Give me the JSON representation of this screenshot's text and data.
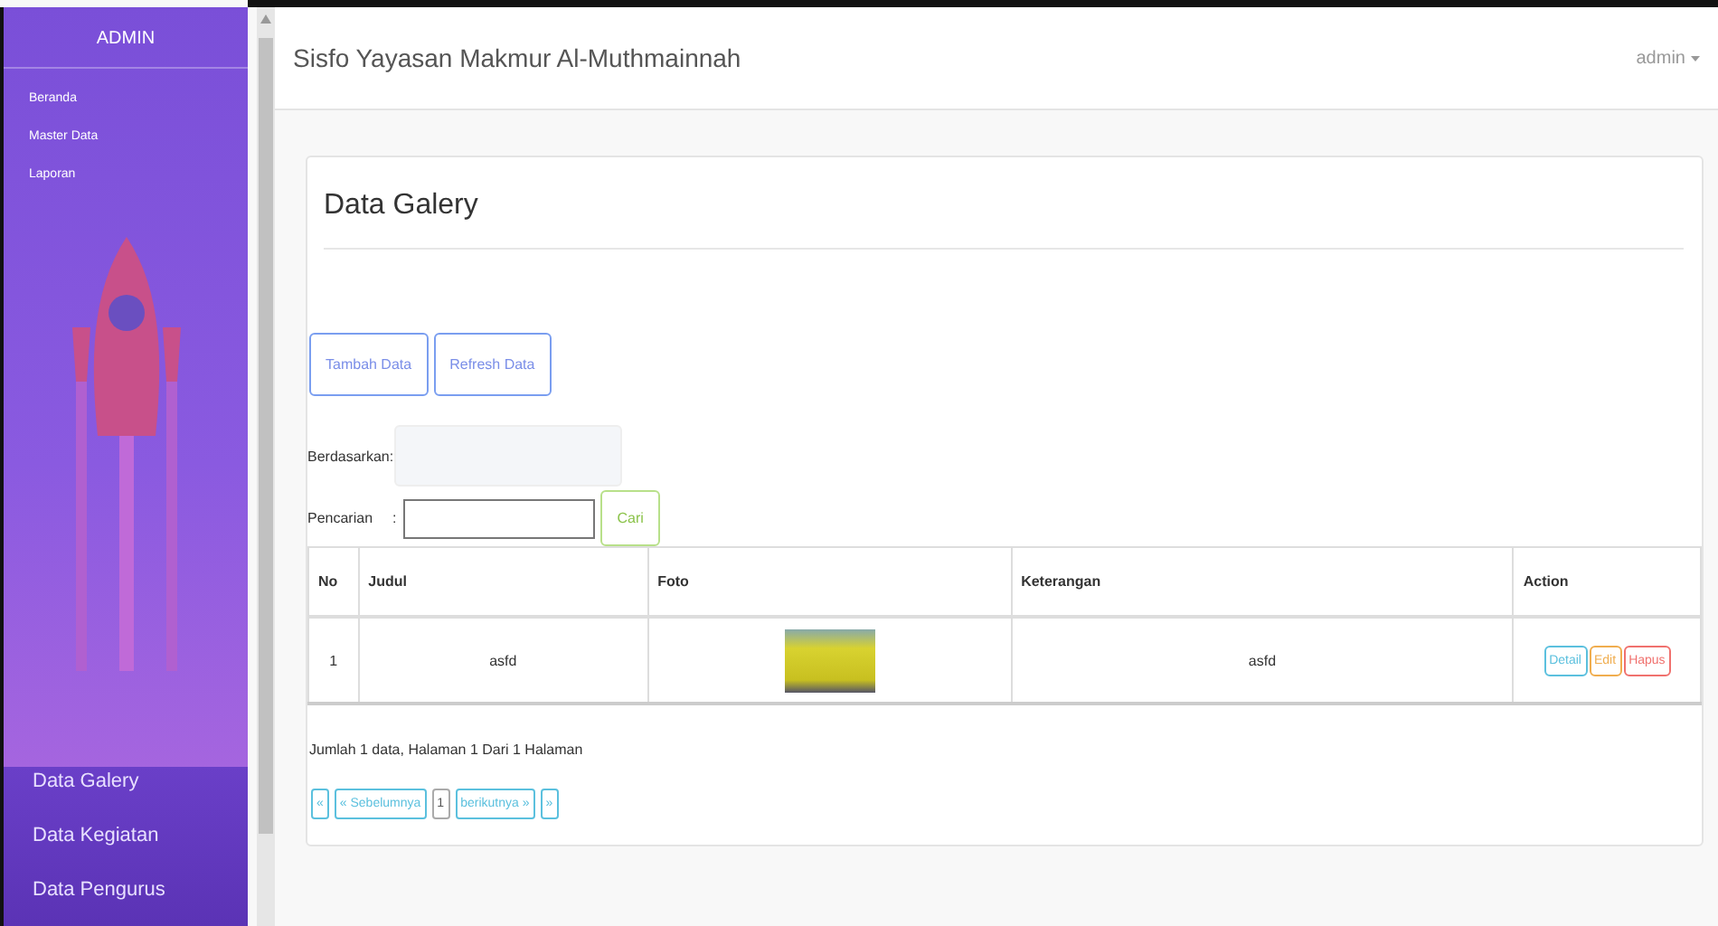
{
  "sidebar": {
    "title": "ADMIN",
    "menu": [
      "Beranda",
      "Master Data",
      "Laporan"
    ],
    "submenu": [
      "Data Galery",
      "Data Kegiatan",
      "Data Pengurus"
    ]
  },
  "navbar": {
    "brand": "Sisfo Yayasan Makmur Al-Muthmainnah",
    "user": "admin"
  },
  "panel": {
    "title": "Data Galery",
    "buttons": [
      "Tambah Data",
      "Refresh Data"
    ],
    "filter": {
      "label": "Berdasarkan:"
    },
    "search": {
      "label": "Pencarian",
      "separator": ":",
      "button": "Cari"
    },
    "table": {
      "columns": [
        "No",
        "Judul",
        "Foto",
        "Keterangan",
        "Action"
      ],
      "rows": [
        {
          "no": "1",
          "judul": "asfd",
          "keterangan": "asfd",
          "actions": [
            {
              "label": "Detail",
              "kind": "detail"
            },
            {
              "label": "Edit",
              "kind": "edit"
            },
            {
              "label": "Hapus",
              "kind": "delete"
            }
          ]
        }
      ]
    },
    "summary": "Jumlah 1 data, Halaman 1 Dari 1 Halaman",
    "pagination": [
      {
        "label": "«",
        "selected": false
      },
      {
        "label": "« Sebelumnya",
        "selected": false
      },
      {
        "label": "1",
        "selected": true
      },
      {
        "label": "berikutnya »",
        "selected": false
      },
      {
        "label": "»",
        "selected": false
      }
    ]
  }
}
